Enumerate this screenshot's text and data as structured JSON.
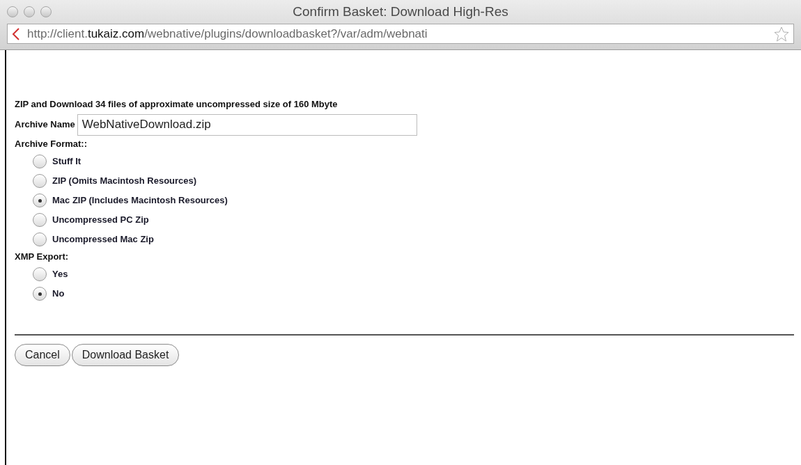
{
  "window": {
    "title": "Confirm Basket: Download High-Res"
  },
  "address_bar": {
    "scheme_host": "http://client.",
    "domain": "tukaiz.com",
    "path": "/webnative/plugins/downloadbasket?/var/adm/webnati"
  },
  "heading": "ZIP and Download 34 files of approximate uncompressed size of 160 Mbyte",
  "archive_name": {
    "label": "Archive Name",
    "value": "WebNativeDownload.zip"
  },
  "archive_format": {
    "label": "Archive Format::",
    "options": [
      {
        "label": "Stuff It",
        "selected": false
      },
      {
        "label": "ZIP (Omits Macintosh Resources)",
        "selected": false
      },
      {
        "label": "Mac ZIP (Includes Macintosh Resources)",
        "selected": true
      },
      {
        "label": "Uncompressed PC Zip",
        "selected": false
      },
      {
        "label": "Uncompressed Mac Zip",
        "selected": false
      }
    ]
  },
  "xmp_export": {
    "label": "XMP Export:",
    "options": [
      {
        "label": "Yes",
        "selected": false
      },
      {
        "label": "No",
        "selected": true
      }
    ]
  },
  "buttons": [
    "Cancel",
    "Download Basket"
  ]
}
